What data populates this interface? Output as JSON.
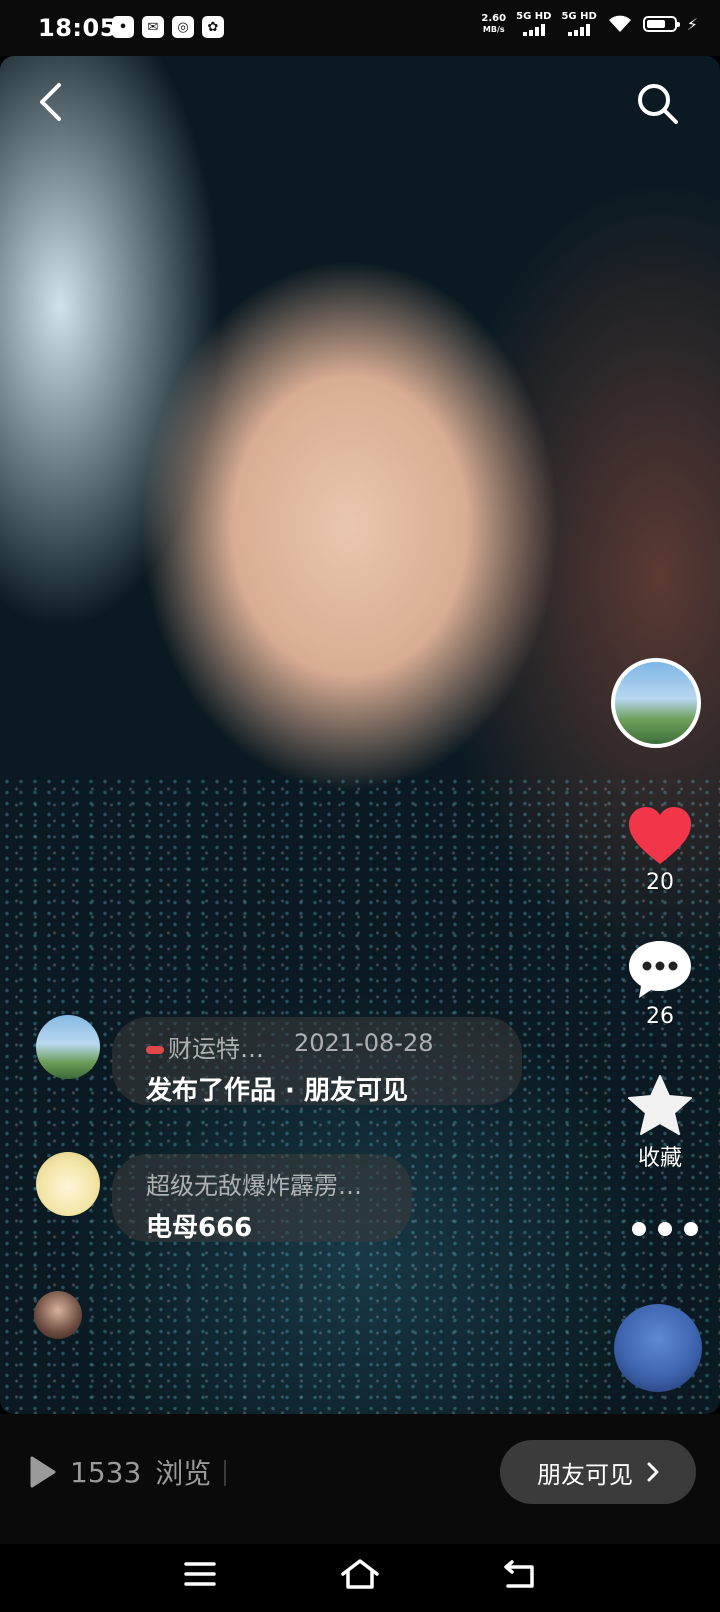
{
  "status_bar": {
    "time": "18:05",
    "app_icons": [
      "unknown-app-icon",
      "chat-app-icon",
      "orbit-app-icon",
      "baidu-app-icon"
    ],
    "net_speed_value": "2.60",
    "net_speed_unit": "MB/s",
    "sim1_label": "5G HD",
    "sim2_label": "5G HD",
    "battery_level": 0.7
  },
  "header": {
    "back_icon": "back-chevron-icon",
    "search_icon": "search-icon"
  },
  "right_rail": {
    "like_count": "20",
    "comment_count": "26",
    "favorite_label": "收藏"
  },
  "comments": [
    {
      "name": "财运特…",
      "date": "2021-08-28",
      "text": "发布了作品 · 朋友可见"
    },
    {
      "name": "超级无敌爆炸霹雳…",
      "text": "电母666"
    }
  ],
  "footer": {
    "views_count": "1533",
    "views_label": "浏览",
    "friends_button_label": "朋友可见"
  },
  "colors": {
    "like": "#f2364a",
    "bubble": "rgba(60,60,60,0.55)",
    "button_bg": "#3b3b3b"
  }
}
